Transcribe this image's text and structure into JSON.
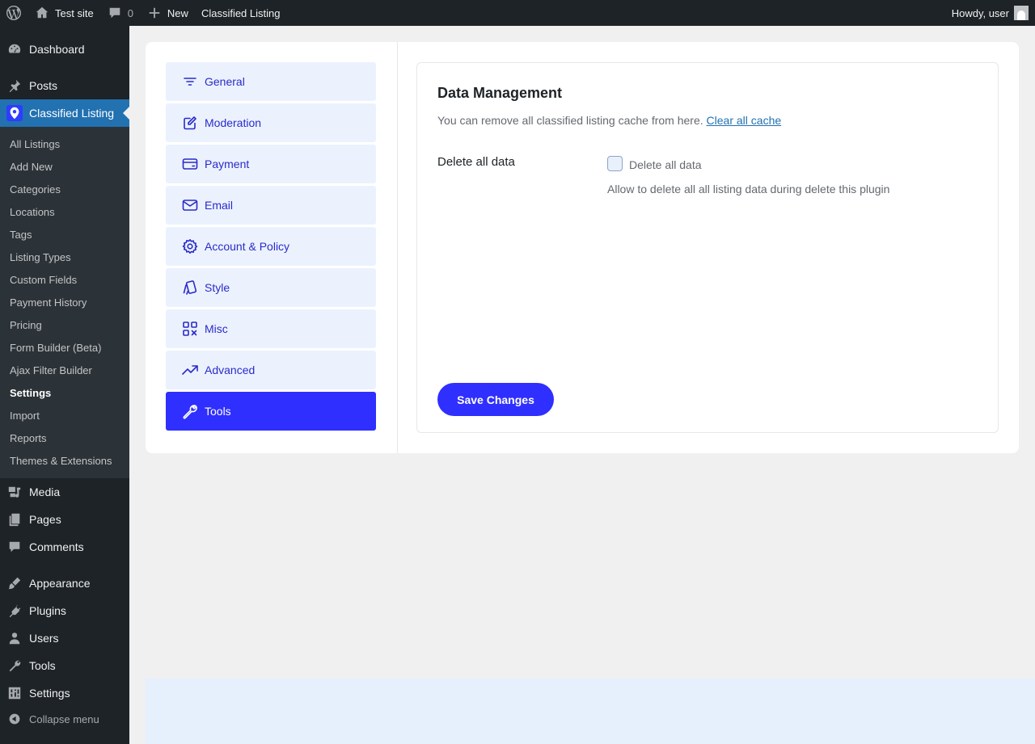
{
  "adminbar": {
    "site_name": "Test site",
    "comments_count": "0",
    "new_label": "New",
    "plugin_label": "Classified Listing",
    "howdy": "Howdy, user"
  },
  "sidebar": {
    "dashboard": "Dashboard",
    "posts": "Posts",
    "classified": "Classified Listing",
    "submenu": [
      "All Listings",
      "Add New",
      "Categories",
      "Locations",
      "Tags",
      "Listing Types",
      "Custom Fields",
      "Payment History",
      "Pricing",
      "Form Builder (Beta)",
      "Ajax Filter Builder",
      "Settings",
      "Import",
      "Reports",
      "Themes & Extensions"
    ],
    "active_submenu": "Settings",
    "media": "Media",
    "pages": "Pages",
    "comments": "Comments",
    "appearance": "Appearance",
    "plugins": "Plugins",
    "users": "Users",
    "tools": "Tools",
    "settings": "Settings",
    "collapse": "Collapse menu"
  },
  "tabs": [
    "General",
    "Moderation",
    "Payment",
    "Email",
    "Account & Policy",
    "Style",
    "Misc",
    "Advanced",
    "Tools"
  ],
  "active_tab": "Tools",
  "card": {
    "title": "Data Management",
    "description": "You can remove all classified listing cache from here.",
    "clear_cache_link": "Clear all cache",
    "field_label": "Delete all data",
    "checkbox_label": "Delete all data",
    "checkbox_checked": false,
    "field_help": "Allow to delete all all listing data during delete this plugin",
    "save_button": "Save Changes"
  },
  "colors": {
    "accent": "#2f2fff",
    "tab_bg": "#ebf2fe",
    "admin_dark": "#1d2327",
    "wp_blue": "#2271b1"
  }
}
